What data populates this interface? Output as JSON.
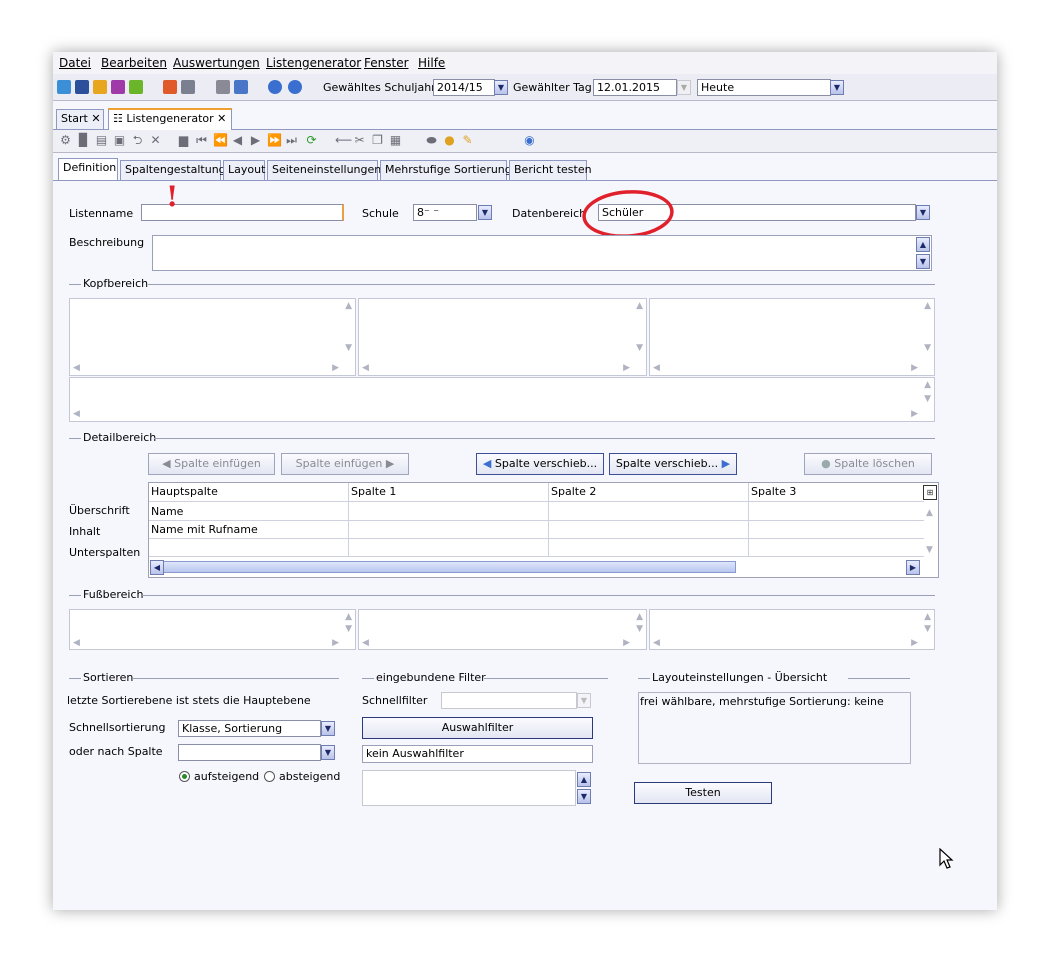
{
  "menu": [
    "Datei",
    "Bearbeiten",
    "Auswertungen",
    "Listengenerator",
    "Fenster",
    "Hilfe"
  ],
  "toolbar": {
    "schuljahr_label": "Gewähltes Schuljahr",
    "schuljahr_value": "2014/15",
    "tag_label": "Gewählter Tag",
    "tag_value": "12.01.2015",
    "heute_value": "Heute"
  },
  "doc_tabs": [
    "Start",
    "Listengenerator"
  ],
  "sub_tabs": [
    "Definition",
    "Spaltengestaltung",
    "Layout",
    "Seiteneinstellungen",
    "Mehrstufige Sortierung",
    "Bericht testen"
  ],
  "form": {
    "listenname_label": "Listenname",
    "listenname_value": "",
    "schule_label": "Schule",
    "schule_value": "8⁻ ⁻",
    "datenbereich_label": "Datenbereich",
    "datenbereich_value": "Schüler",
    "beschreibung_label": "Beschreibung",
    "annotation_mark": "!"
  },
  "sections": {
    "kopf": "Kopfbereich",
    "detail": "Detailbereich",
    "fuss": "Fußbereich",
    "sortieren": "Sortieren",
    "filter": "eingebundene Filter",
    "layout": "Layouteinstellungen - Übersicht"
  },
  "detail_buttons": {
    "einf_left": "Spalte einfügen",
    "einf_right": "Spalte einfügen",
    "versch_left": "Spalte verschieb...",
    "versch_right": "Spalte verschieb...",
    "loeschen": "Spalte löschen"
  },
  "grid": {
    "row_labels": [
      "Überschrift",
      "Inhalt",
      "Unterspalten"
    ],
    "headers": [
      "Hauptspalte",
      "Spalte 1",
      "Spalte 2",
      "Spalte 3"
    ],
    "rows": [
      [
        "Name",
        "",
        "",
        ""
      ],
      [
        "Name mit Rufname",
        "",
        "",
        ""
      ],
      [
        "",
        "",
        "",
        ""
      ]
    ]
  },
  "sort": {
    "note": "letzte Sortierebene ist stets die Hauptebene",
    "schnell_label": "Schnellsortierung",
    "schnell_value": "Klasse, Sortierung",
    "spalte_label": "oder nach Spalte",
    "spalte_value": "",
    "asc": "aufsteigend",
    "desc": "absteigend"
  },
  "filter": {
    "schnellfilter_label": "Schnellfilter",
    "auswahl_button": "Auswahlfilter",
    "auswahl_value": "kein Auswahlfilter"
  },
  "layout": {
    "summary": "frei wählbare, mehrstufige Sortierung: keine",
    "testen_button": "Testen"
  }
}
